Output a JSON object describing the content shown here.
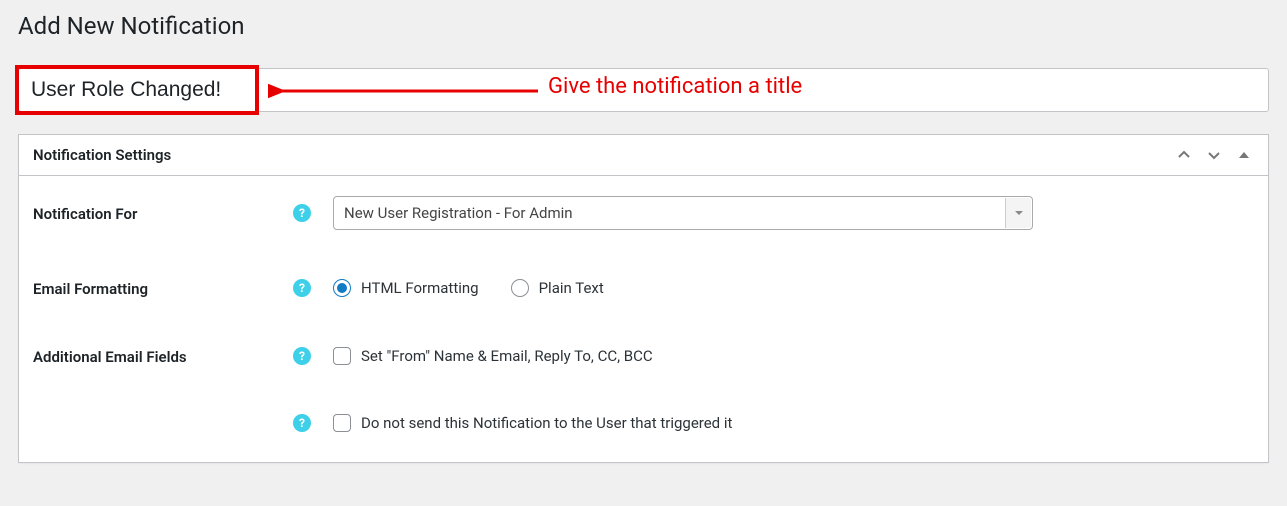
{
  "page": {
    "title": "Add New Notification"
  },
  "titleField": {
    "value": "User Role Changed!"
  },
  "annotation": {
    "text": "Give the notification a title"
  },
  "panel": {
    "header": "Notification Settings"
  },
  "fields": {
    "notificationFor": {
      "label": "Notification For",
      "selected": "New User Registration - For Admin"
    },
    "emailFormatting": {
      "label": "Email Formatting",
      "optHtml": "HTML Formatting",
      "optPlain": "Plain Text"
    },
    "additionalEmail": {
      "label": "Additional Email Fields",
      "opt1": "Set \"From\" Name & Email, Reply To, CC, BCC",
      "opt2": "Do not send this Notification to the User that triggered it"
    }
  },
  "helpGlyph": "?"
}
